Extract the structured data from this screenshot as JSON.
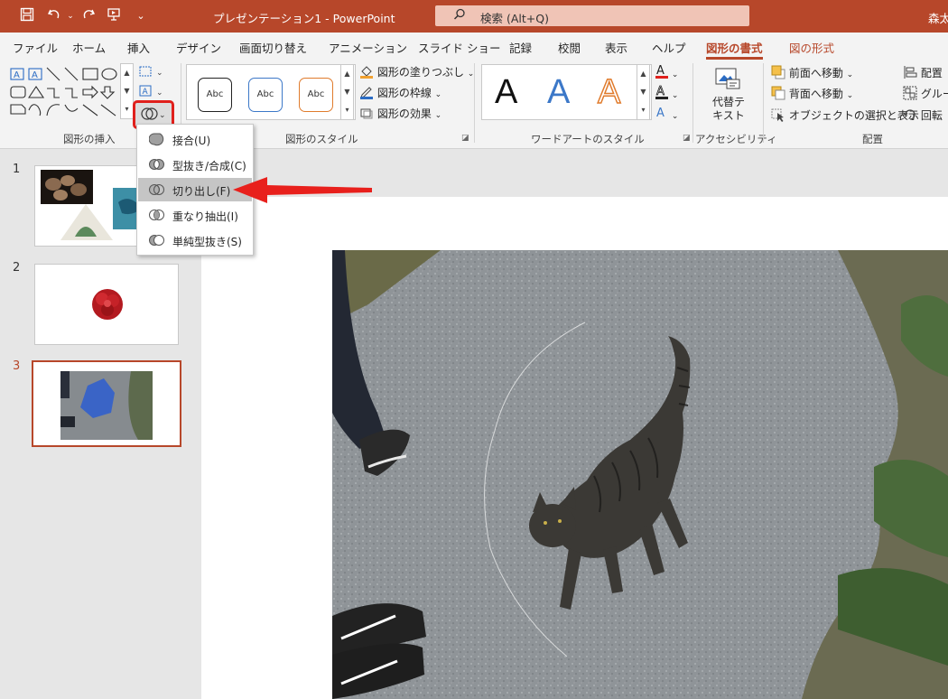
{
  "titlebar": {
    "doc_title": "プレゼンテーション1  -  PowerPoint",
    "search_placeholder": "検索 (Alt+Q)",
    "user": "森太"
  },
  "tabs": [
    {
      "label": "ファイル"
    },
    {
      "label": "ホーム"
    },
    {
      "label": "挿入"
    },
    {
      "label": "デザイン"
    },
    {
      "label": "画面切り替え"
    },
    {
      "label": "アニメーション"
    },
    {
      "label": "スライド ショー"
    },
    {
      "label": "記録"
    },
    {
      "label": "校閲"
    },
    {
      "label": "表示"
    },
    {
      "label": "ヘルプ"
    },
    {
      "label": "図形の書式",
      "active": true
    },
    {
      "label": "図の形式"
    }
  ],
  "ribbon": {
    "groups": {
      "insert_shapes": "図形の挿入",
      "shape_styles": "図形のスタイル",
      "wordart_styles": "ワードアートのスタイル",
      "accessibility": "アクセシビリティ",
      "arrange": "配置"
    },
    "style_thumb_text": "Abc",
    "shape_fill": "図形の塗りつぶし",
    "shape_outline": "図形の枠線",
    "shape_effects": "図形の効果",
    "wordart_letter": "A",
    "alt_text_line1": "代替テ",
    "alt_text_line2": "キスト",
    "bring_forward": "前面へ移動",
    "send_backward": "背面へ移動",
    "selection_pane": "オブジェクトの選択と表示",
    "align": "配置",
    "group": "グルー",
    "rotate": "回転"
  },
  "merge_menu": {
    "items": [
      {
        "label": "接合(U)",
        "selected": false
      },
      {
        "label": "型抜き/合成(C)",
        "selected": false
      },
      {
        "label": "切り出し(F)",
        "selected": true
      },
      {
        "label": "重なり抽出(I)",
        "selected": false
      },
      {
        "label": "単純型抜き(S)",
        "selected": false
      }
    ]
  },
  "slides": [
    {
      "number": "1"
    },
    {
      "number": "2"
    },
    {
      "number": "3",
      "active": true
    }
  ],
  "colors": {
    "brand": "#b7472a",
    "highlight": "#e0201c",
    "arrow": "#e8201c"
  }
}
